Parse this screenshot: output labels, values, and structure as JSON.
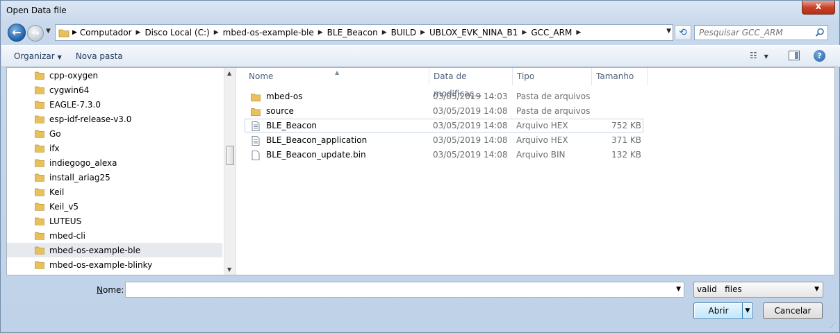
{
  "window": {
    "title": "Open Data file",
    "close_label": "x"
  },
  "nav": {
    "back_label": "←",
    "forward_label": "→",
    "breadcrumbs": [
      "Computador",
      "Disco Local (C:)",
      "mbed-os-example-ble",
      "BLE_Beacon",
      "BUILD",
      "UBLOX_EVK_NINA_B1",
      "GCC_ARM"
    ],
    "search_placeholder": "Pesquisar GCC_ARM"
  },
  "toolbar": {
    "organize_label": "Organizar",
    "new_folder_label": "Nova pasta"
  },
  "tree": {
    "items": [
      {
        "label": "cpp-oxygen"
      },
      {
        "label": "cygwin64"
      },
      {
        "label": "EAGLE-7.3.0"
      },
      {
        "label": "esp-idf-release-v3.0"
      },
      {
        "label": "Go"
      },
      {
        "label": "ifx"
      },
      {
        "label": "indiegogo_alexa"
      },
      {
        "label": "install_ariag25"
      },
      {
        "label": "Keil"
      },
      {
        "label": "Keil_v5"
      },
      {
        "label": "LUTEUS"
      },
      {
        "label": "mbed-cli"
      },
      {
        "label": "mbed-os-example-ble"
      },
      {
        "label": "mbed-os-example-blinky"
      }
    ],
    "selected": "mbed-os-example-ble"
  },
  "files": {
    "columns": [
      "Nome",
      "Data de modificaç...",
      "Tipo",
      "Tamanho"
    ],
    "rows": [
      {
        "name": "mbed-os",
        "date": "03/05/2019 14:03",
        "type": "Pasta de arquivos",
        "size": "",
        "icon": "folder-icon"
      },
      {
        "name": "source",
        "date": "03/05/2019 14:08",
        "type": "Pasta de arquivos",
        "size": "",
        "icon": "folder-icon"
      },
      {
        "name": "BLE_Beacon",
        "date": "03/05/2019 14:08",
        "type": "Arquivo HEX",
        "size": "752 KB",
        "icon": "text-file-icon"
      },
      {
        "name": "BLE_Beacon_application",
        "date": "03/05/2019 14:08",
        "type": "Arquivo HEX",
        "size": "371 KB",
        "icon": "text-file-icon"
      },
      {
        "name": "BLE_Beacon_update.bin",
        "date": "03/05/2019 14:08",
        "type": "Arquivo BIN",
        "size": "132 KB",
        "icon": "blank-file-icon"
      }
    ],
    "focused": "BLE_Beacon"
  },
  "footer": {
    "name_label_accel": "N",
    "name_label_rest": "ome:",
    "name_value": "",
    "filter_value": "valid   files",
    "open_label": "Abrir",
    "cancel_label": "Cancelar"
  },
  "colors": {
    "folder": "#e8c05c",
    "accent": "#3c7fb1",
    "close": "#c9432b"
  }
}
